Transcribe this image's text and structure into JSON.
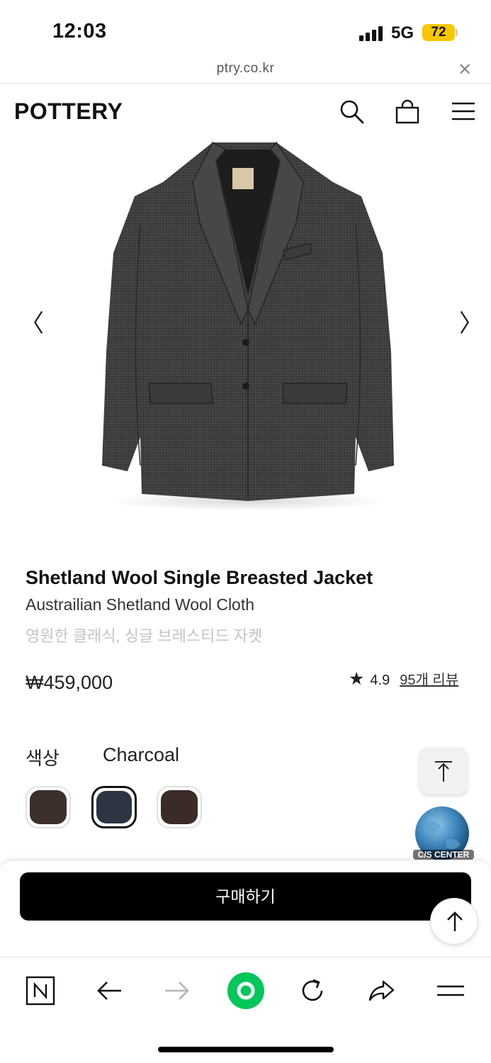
{
  "status_bar": {
    "time": "12:03",
    "network": "5G",
    "battery": "72",
    "battery_color": "#f6c700"
  },
  "browser": {
    "url": "ptry.co.kr",
    "close_icon": "close-icon"
  },
  "header": {
    "logo": "POTTERY",
    "icons": [
      "search-icon",
      "shopping-bag-icon",
      "menu-icon"
    ]
  },
  "gallery": {
    "image": "charcoal-wool-jacket-photo",
    "prev_glyph": "〈",
    "next_glyph": "〉"
  },
  "product": {
    "title": "Shetland Wool Single Breasted Jacket",
    "subtitle": "Austrailian Shetland Wool Cloth",
    "description": "영원한 클래식, 싱글 브레스티드 자켓",
    "price": "₩459,000",
    "rating_star": "★",
    "rating": "4.9",
    "reviews": "95개 리뷰"
  },
  "options": {
    "color_label": "색상",
    "color_value": "Charcoal",
    "swatches": [
      {
        "name": "brown",
        "color": "#3d2f2b",
        "selected": false
      },
      {
        "name": "charcoal",
        "color": "#2d3442",
        "selected": true
      },
      {
        "name": "dark-brown",
        "color": "#3b2b27",
        "selected": false
      }
    ]
  },
  "floating": {
    "top_icon": "arrow-to-top-icon",
    "cs_label": "C/S CENTER",
    "scroll_up_icon": "arrow-up-icon"
  },
  "purchase": {
    "buy_label": "구매하기"
  },
  "toolbar": {
    "items": [
      "naver-icon",
      "back-icon",
      "forward-icon",
      "green-dot-icon",
      "reload-icon",
      "share-icon",
      "menu-icon"
    ],
    "accent": "#03c75a"
  }
}
